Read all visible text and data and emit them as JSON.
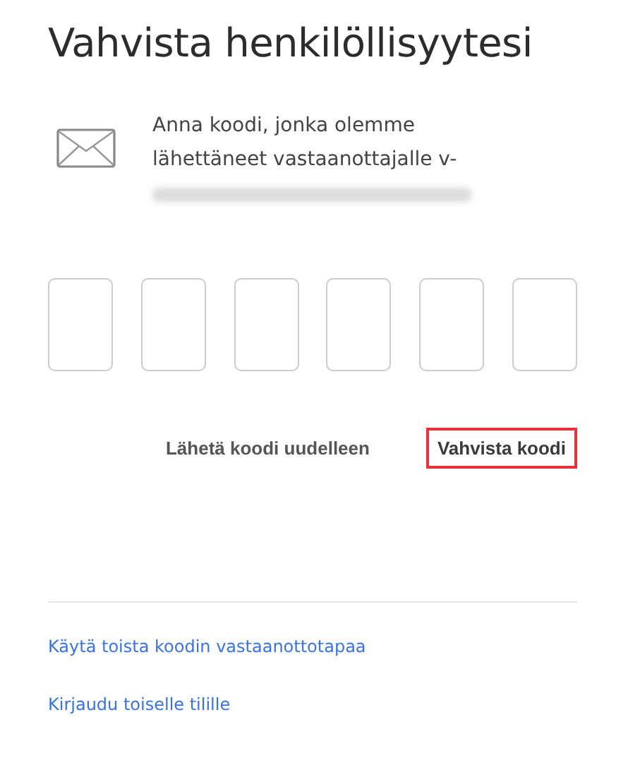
{
  "title": "Vahvista henkilöllisyytesi",
  "message": "Anna koodi, jonka olemme lähettäneet vastaanottajalle v-",
  "recipient": {
    "kind": "blurred"
  },
  "code_fields": [
    {
      "kind": "digit"
    },
    {
      "kind": "digit"
    },
    {
      "kind": "digit"
    },
    {
      "kind": "digit"
    },
    {
      "kind": "digit"
    },
    {
      "kind": "digit"
    }
  ],
  "buttons": [
    {
      "label": "Lähetä koodi uudelleen",
      "highlighted": false
    },
    {
      "label": "Vahvista koodi",
      "highlighted": true
    }
  ],
  "links": [
    "Käytä toista koodin vastaanottotapaa",
    "Kirjaudu toiselle tilille"
  ]
}
